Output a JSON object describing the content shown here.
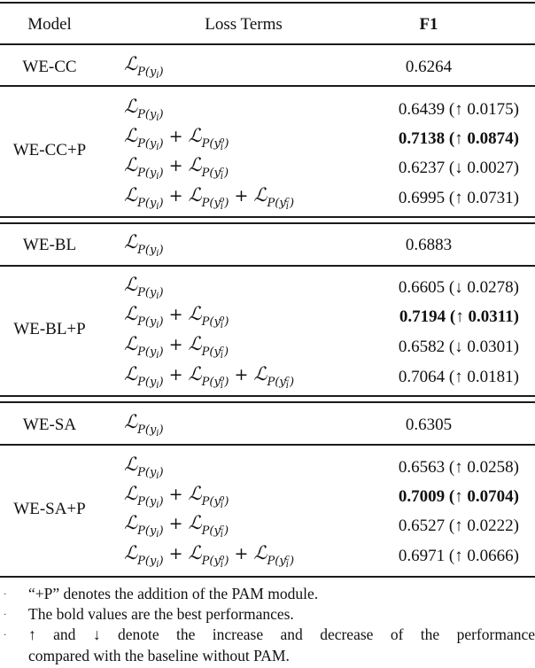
{
  "header": {
    "model": "Model",
    "loss_terms": "Loss Terms",
    "f1": "F1"
  },
  "math": {
    "L": "ℒ",
    "P_open": "P(",
    "y": "y",
    "i": "i",
    "close": ")",
    "o": "o",
    "c": "c",
    "plus": "+"
  },
  "groups": [
    {
      "baseline": {
        "model": "WE-CC",
        "loss": [
          "y"
        ],
        "f1": "0.6264"
      },
      "pam": {
        "model": "WE-CC+P",
        "rows": [
          {
            "loss": [
              "y"
            ],
            "f1": "0.6439 (↑ 0.0175)",
            "bold": false
          },
          {
            "loss": [
              "y",
              "o"
            ],
            "f1": "0.7138 (↑ 0.0874)",
            "bold": true
          },
          {
            "loss": [
              "y",
              "c"
            ],
            "f1": "0.6237 (↓ 0.0027)",
            "bold": false
          },
          {
            "loss": [
              "y",
              "o",
              "c"
            ],
            "f1": "0.6995 (↑ 0.0731)",
            "bold": false
          }
        ]
      }
    },
    {
      "baseline": {
        "model": "WE-BL",
        "loss": [
          "y"
        ],
        "f1": "0.6883"
      },
      "pam": {
        "model": "WE-BL+P",
        "rows": [
          {
            "loss": [
              "y"
            ],
            "f1": "0.6605 (↓ 0.0278)",
            "bold": false
          },
          {
            "loss": [
              "y",
              "o"
            ],
            "f1": "0.7194 (↑ 0.0311)",
            "bold": true
          },
          {
            "loss": [
              "y",
              "c"
            ],
            "f1": "0.6582 (↓ 0.0301)",
            "bold": false
          },
          {
            "loss": [
              "y",
              "o",
              "c"
            ],
            "f1": "0.7064 (↑ 0.0181)",
            "bold": false
          }
        ]
      }
    },
    {
      "baseline": {
        "model": "WE-SA",
        "loss": [
          "y"
        ],
        "f1": "0.6305"
      },
      "pam": {
        "model": "WE-SA+P",
        "rows": [
          {
            "loss": [
              "y"
            ],
            "f1": "0.6563 (↑ 0.0258)",
            "bold": false
          },
          {
            "loss": [
              "y",
              "o"
            ],
            "f1": "0.7009 (↑ 0.0704)",
            "bold": true
          },
          {
            "loss": [
              "y",
              "c"
            ],
            "f1": "0.6527 (↑ 0.0222)",
            "bold": false
          },
          {
            "loss": [
              "y",
              "o",
              "c"
            ],
            "f1": "0.6971 (↑ 0.0666)",
            "bold": false
          }
        ]
      }
    }
  ],
  "footnotes": [
    "“+P” denotes the addition of the PAM module.",
    "The bold values are the best performances.",
    "↑ and ↓ denote the increase and decrease of the performance",
    "compared with the baseline without PAM."
  ]
}
